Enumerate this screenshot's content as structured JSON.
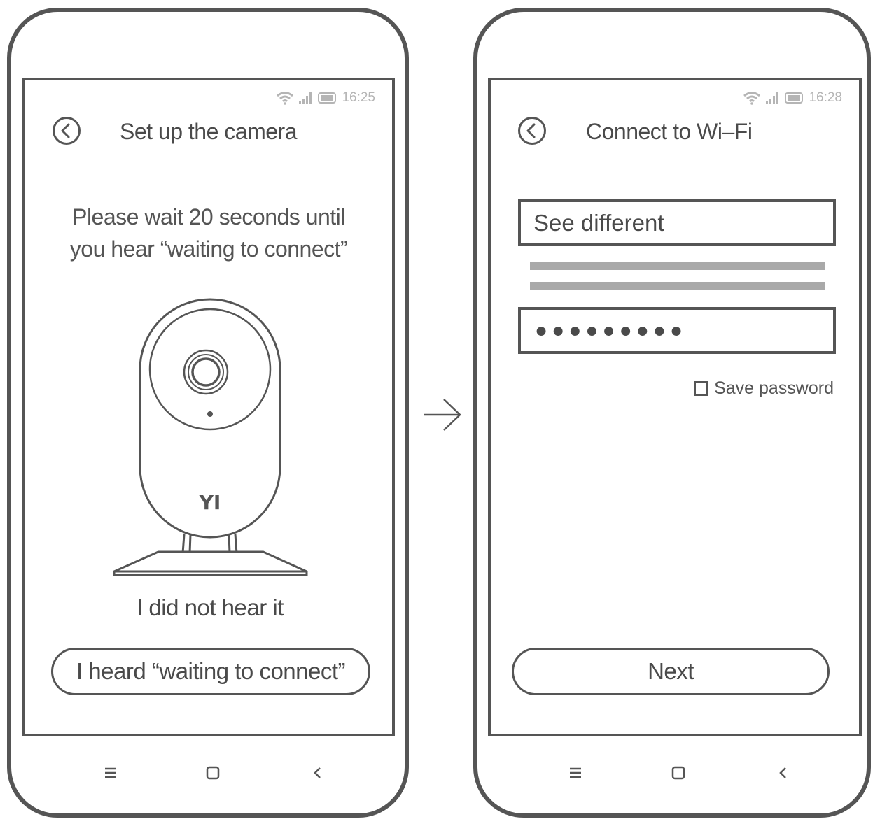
{
  "left_phone": {
    "status": {
      "time": "16:25"
    },
    "header": {
      "title": "Set up the camera",
      "back_icon": "back-circle-icon"
    },
    "instruction": {
      "line1": "Please wait 20 seconds until",
      "line2": "you hear “waiting to connect”"
    },
    "camera_brand": "YI",
    "not_heard_link": "I  did not hear it",
    "heard_button": "I heard “waiting to connect”"
  },
  "right_phone": {
    "status": {
      "time": "16:28"
    },
    "header": {
      "title": "Connect to Wi–Fi",
      "back_icon": "back-circle-icon"
    },
    "ssid_field": {
      "value": "See different"
    },
    "password_field": {
      "value": "●●●●●●●●●"
    },
    "save_password": {
      "label": "Save password",
      "checked": false
    },
    "next_button": "Next"
  },
  "nav_icons": [
    "menu-icon",
    "home-icon",
    "back-icon"
  ],
  "colors": {
    "outline": "#555555",
    "status_text": "#b5b5b5",
    "placeholder_bar": "#a9a9a9"
  }
}
